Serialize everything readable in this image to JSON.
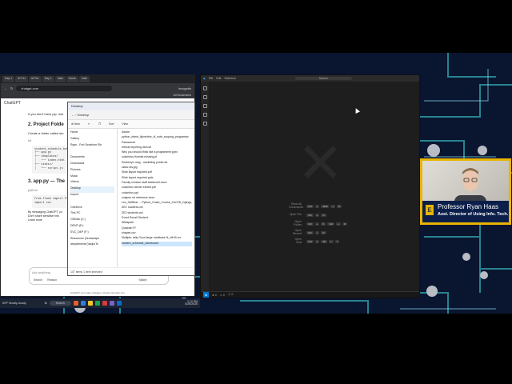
{
  "browser": {
    "tabs": [
      "Day 1",
      "AI Per",
      "AI Per",
      "Day 1",
      "data",
      "Home",
      "Instr"
    ],
    "url": "chatgpt.com",
    "profile": "Incognito",
    "bookmarks": "All Bookmarks",
    "app_label": "ChatGPT",
    "line1": "If you don't have pip, inst",
    "step2_title": "Project Folde",
    "step2_desc": "Create a folder called stu",
    "code1_label": "txt",
    "code1": "student_schedule_bot/\n├── app.py\n├── templates/\n│   └── index.html\n├── static/\n│   └── script.js",
    "step3_title": "app.py — The",
    "code2_label": "python",
    "code2": "from flask import Fla\nimport csv",
    "notice": "By messaging ChatGPT, yo\nDon't share sensitive info\nLearn more",
    "input_placeholder": "Ask anything",
    "btn_search": "Search",
    "btn_reason": "Reason",
    "btn_voice": "Voice",
    "footer": "ChatGPT can make mistakes. Check important info."
  },
  "explorer": {
    "title": "Desktop",
    "new_label": "New",
    "path": "Desktop",
    "sort_label": "Sort",
    "view_label": "View",
    "nav": [
      "Home",
      "Gallery",
      "Ryan - Fort Dearborn Ele",
      "",
      "Documents",
      "Downloads",
      "Pictures",
      "Music",
      "Videos",
      "Desktop",
      "Import",
      "",
      "OneDrive",
      "This PC",
      "OSDisk (C:)",
      "DRVR (E:)",
      "SVC_DEP (F:)",
      "Resources (\\\\educadps",
      "departments (\\\\adpsTs"
    ],
    "files": [
      "Adobe",
      "python_intent_llpixelnhe_dl_note_scoping_programtw",
      "Passwords",
      "retreat reporting dsm.txt",
      "Why you should think like a programmer.pptx",
      "columbus thumbs missing.pf",
      "Kimberly's msg - marketing poster.txt",
      "class.csv.jpg",
      "Slide layout required.pdf",
      "Slide layout required.pptx",
      "Faculty revision staff statement.docx",
      "columbus dinner exhibit.pdf",
      "columbus.ppt",
      "colapse ref reference.docx",
      "Lec_Halftime ... Python_Crash_Course_2nd ED_Django_Graphs",
      "ZEC students.xls",
      "ZE2 students.csv",
      "Event Recall Student",
      "Wikispark",
      "Quatrain Ff",
      "shapes.csv",
      "Multiple: tally Good large: seatbase N_cfk 5Lrxx",
      "student_schedule_dashboard"
    ],
    "status": "107 items  1 item selected"
  },
  "taskbar": {
    "weather_temp": "69°F",
    "weather_desc": "Mostly cloudy",
    "search": "Search",
    "time": "1:12 PM",
    "date": "5/29/2025"
  },
  "vscode": {
    "menu": [
      "File",
      "Edit",
      "Selection"
    ],
    "search": "Search",
    "shortcuts": [
      {
        "label": "Show All Commands",
        "keys": [
          "Ctrl",
          "+",
          "Shift",
          "+",
          "P"
        ]
      },
      {
        "label": "Open File",
        "keys": [
          "Ctrl",
          "+",
          "O"
        ]
      },
      {
        "label": "Open Folder",
        "keys": [
          "Ctrl",
          "+",
          "K",
          "Ctrl",
          "+",
          "O"
        ]
      },
      {
        "label": "Open Recent",
        "keys": [
          "Ctrl",
          "+",
          "R"
        ]
      },
      {
        "label": "Open Chat",
        "keys": [
          "Ctrl",
          "+",
          "Alt",
          "+",
          "I"
        ]
      }
    ],
    "status_items": [
      "⊗ 0",
      "⚠ 0",
      "ⓘ 0"
    ]
  },
  "webcam": {
    "name": "Professor Ryan Haas",
    "title": "Asst. Director of Using Info. Tech.",
    "logo_letter": "E",
    "border_color": "#e8b400",
    "bar_color": "#0b1f4a"
  },
  "colors": {
    "pcb_trace": "#2f9fa8",
    "pcb_glow": "#8fe8ff",
    "node": "#b8bcc4"
  }
}
